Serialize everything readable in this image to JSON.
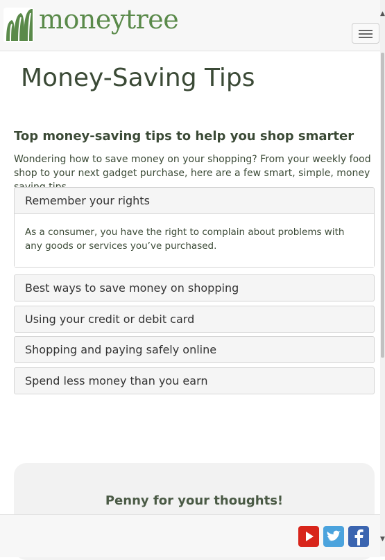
{
  "header": {
    "brand": "moneytree",
    "logo_icon": "moneytree-logo-icon",
    "menu_icon": "hamburger-menu-icon"
  },
  "main": {
    "title": "Money-Saving Tips",
    "subheading": "Top money-saving tips to help you shop smarter",
    "intro": "Wondering how to save money on your shopping? From your weekly food shop to your next gadget purchase, here are a few smart, simple, money saving tips.",
    "accordion": [
      {
        "title": "Remember your rights",
        "expanded": true,
        "body": "As a consumer, you have the right to complain about problems with any goods or services you’ve purchased."
      },
      {
        "title": "Best ways to save money on shopping",
        "expanded": false
      },
      {
        "title": "Using your credit or debit card",
        "expanded": false
      },
      {
        "title": "Shopping and paying safely online",
        "expanded": false
      },
      {
        "title": "Spend less money than you earn",
        "expanded": false
      }
    ]
  },
  "feedback": {
    "title": "Penny for your thoughts!"
  },
  "footer": {
    "social": [
      "youtube-icon",
      "twitter-icon",
      "facebook-icon"
    ]
  },
  "colors": {
    "brand_green": "#5a8a4a",
    "heading": "#3b4a36",
    "youtube": "#d8251b",
    "twitter": "#4ba3dd",
    "facebook": "#3b65b0"
  }
}
